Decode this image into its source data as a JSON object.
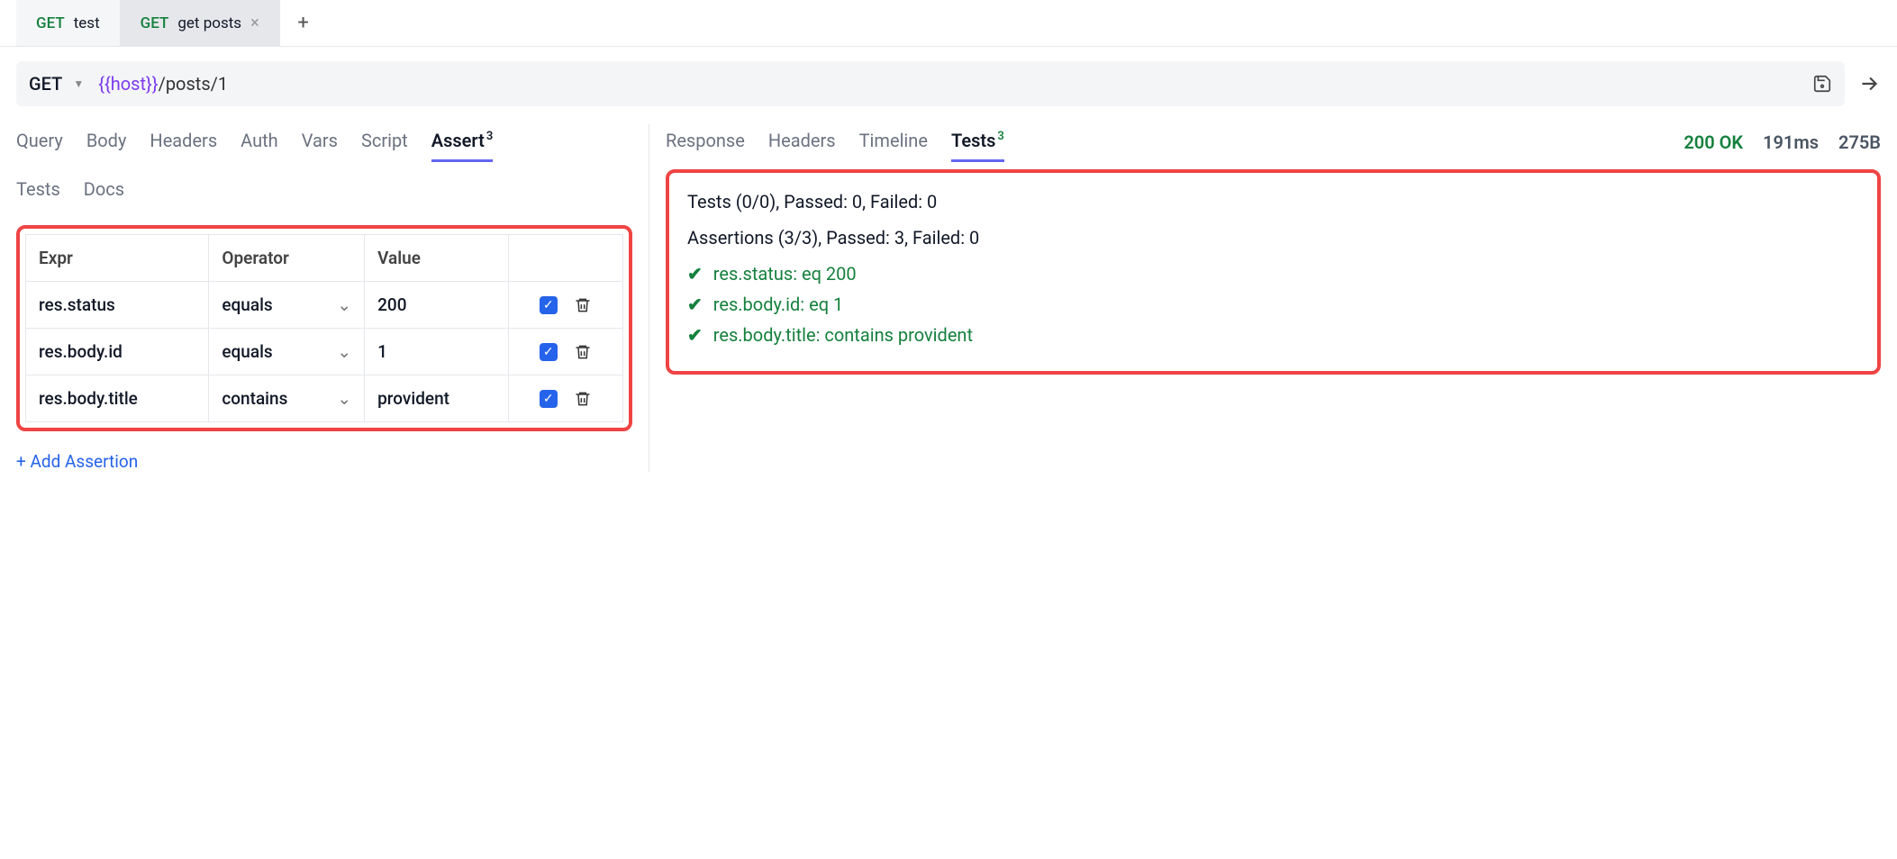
{
  "tabs": [
    {
      "method": "GET",
      "name": "test",
      "active": false,
      "closeable": false
    },
    {
      "method": "GET",
      "name": "get posts",
      "active": true,
      "closeable": true
    }
  ],
  "request": {
    "method": "GET",
    "url_var": "{{host}}",
    "url_path": "/posts/1"
  },
  "request_tabs": {
    "row1": [
      "Query",
      "Body",
      "Headers",
      "Auth",
      "Vars",
      "Script"
    ],
    "assert": {
      "label": "Assert",
      "count": "3"
    },
    "row2": [
      "Tests",
      "Docs"
    ]
  },
  "assert_table": {
    "headers": {
      "expr": "Expr",
      "operator": "Operator",
      "value": "Value"
    },
    "rows": [
      {
        "expr": "res.status",
        "operator": "equals",
        "value": "200"
      },
      {
        "expr": "res.body.id",
        "operator": "equals",
        "value": "1"
      },
      {
        "expr": "res.body.title",
        "operator": "contains",
        "value": "provident"
      }
    ]
  },
  "add_assertion_label": "+ Add Assertion",
  "response_tabs": {
    "items": [
      "Response",
      "Headers",
      "Timeline"
    ],
    "tests": {
      "label": "Tests",
      "count": "3"
    }
  },
  "response_meta": {
    "status": "200 OK",
    "time": "191ms",
    "size": "275B"
  },
  "results": {
    "tests_summary": "Tests (0/0), Passed: 0, Failed: 0",
    "asserts_summary": "Assertions (3/3), Passed: 3, Failed: 0",
    "lines": [
      "res.status: eq 200",
      "res.body.id: eq 1",
      "res.body.title: contains provident"
    ]
  }
}
